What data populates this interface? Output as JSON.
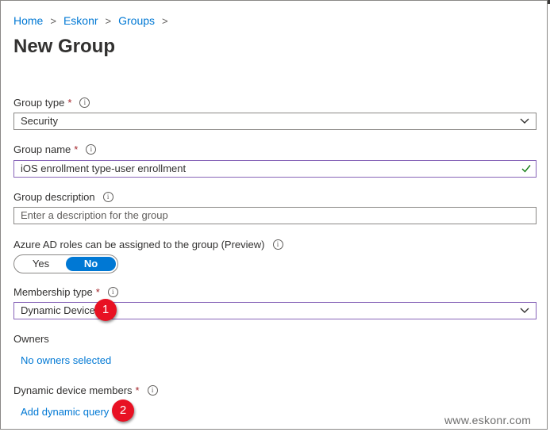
{
  "breadcrumb": {
    "home": "Home",
    "tenant": "Eskonr",
    "groups": "Groups",
    "separator": ">"
  },
  "page_title": "New Group",
  "fields": {
    "group_type": {
      "label": "Group type",
      "required": "*",
      "value": "Security"
    },
    "group_name": {
      "label": "Group name",
      "required": "*",
      "value": "iOS enrollment type-user enrollment"
    },
    "group_description": {
      "label": "Group description",
      "placeholder": "Enter a description for the group"
    },
    "azure_roles": {
      "label": "Azure AD roles can be assigned to the group (Preview)",
      "yes": "Yes",
      "no": "No",
      "selected": "No"
    },
    "membership_type": {
      "label": "Membership type",
      "required": "*",
      "value": "Dynamic Device"
    },
    "owners": {
      "label": "Owners",
      "link": "No owners selected"
    },
    "dynamic_members": {
      "label": "Dynamic device members",
      "required": "*",
      "link": "Add dynamic query"
    }
  },
  "info_glyph": "i",
  "callouts": {
    "one": "1",
    "two": "2"
  },
  "watermark": "www.eskonr.com",
  "colors": {
    "accent": "#0078d4",
    "required": "#a4262c",
    "focus_border": "#8764b8",
    "callout": "#e81123",
    "valid": "#107c10"
  }
}
